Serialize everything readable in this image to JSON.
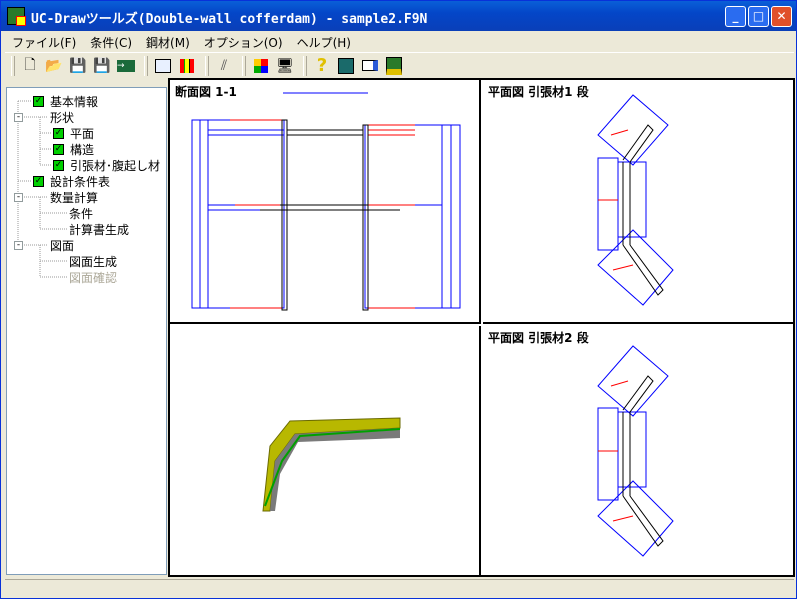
{
  "window": {
    "title": "UC-Drawツールズ(Double-wall cofferdam) - sample2.F9N",
    "minimize": "_",
    "maximize": "□",
    "close": "✕"
  },
  "menu": [
    "ファイル(F)",
    "条件(C)",
    "鋼材(M)",
    "オプション(O)",
    "ヘルプ(H)"
  ],
  "toolbar": [
    "new-file",
    "open-folder",
    "save",
    "save-as",
    "exit",
    "layout",
    "grid-color",
    "steel-beam",
    "palette",
    "computer",
    "help",
    "window",
    "card",
    "app"
  ],
  "tree": {
    "items": [
      {
        "label": "基本情報",
        "checked": true
      },
      {
        "label": "形状"
      },
      {
        "label": "平面",
        "checked": true
      },
      {
        "label": "構造",
        "checked": true
      },
      {
        "label": "引張材･腹起し材",
        "checked": true
      },
      {
        "label": "設計条件表",
        "checked": true
      },
      {
        "label": "数量計算"
      },
      {
        "label": "条件"
      },
      {
        "label": "計算書生成"
      },
      {
        "label": "図面"
      },
      {
        "label": "図面生成"
      },
      {
        "label": "図面確認",
        "disabled": true
      }
    ]
  },
  "panels": {
    "section": "断面図 1-1",
    "plan1": "平面図 引張材1 段",
    "plan2": "平面図 引張材2 段",
    "view3d": ""
  },
  "colors": {
    "dim": "#0000ff",
    "red": "#ff0000",
    "green": "#00a000",
    "olive": "#b8b800"
  }
}
